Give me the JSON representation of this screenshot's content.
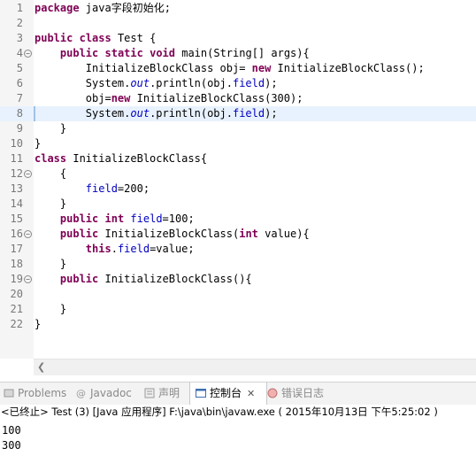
{
  "editor": {
    "lines": [
      {
        "num": "1",
        "parts": [
          [
            "kw",
            "package"
          ],
          [
            "t",
            " java字段初始化;"
          ]
        ]
      },
      {
        "num": "2",
        "parts": []
      },
      {
        "num": "3",
        "parts": [
          [
            "kw",
            "public"
          ],
          [
            "t",
            " "
          ],
          [
            "kw",
            "class"
          ],
          [
            "t",
            " Test {"
          ]
        ]
      },
      {
        "num": "4",
        "fold": true,
        "parts": [
          [
            "t",
            "    "
          ],
          [
            "kw",
            "public"
          ],
          [
            "t",
            " "
          ],
          [
            "kw",
            "static"
          ],
          [
            "t",
            " "
          ],
          [
            "kw",
            "void"
          ],
          [
            "t",
            " main(String[] args){"
          ]
        ]
      },
      {
        "num": "5",
        "parts": [
          [
            "t",
            "        InitializeBlockClass obj= "
          ],
          [
            "kw",
            "new"
          ],
          [
            "t",
            " InitializeBlockClass();"
          ]
        ]
      },
      {
        "num": "6",
        "parts": [
          [
            "t",
            "        System."
          ],
          [
            "st",
            "out"
          ],
          [
            "t",
            ".println(obj."
          ],
          [
            "fld",
            "field"
          ],
          [
            "t",
            ");"
          ]
        ]
      },
      {
        "num": "7",
        "parts": [
          [
            "t",
            "        obj="
          ],
          [
            "kw",
            "new"
          ],
          [
            "t",
            " InitializeBlockClass(300);"
          ]
        ]
      },
      {
        "num": "8",
        "current": true,
        "parts": [
          [
            "t",
            "        System."
          ],
          [
            "st",
            "out"
          ],
          [
            "t",
            ".println(obj."
          ],
          [
            "fld",
            "field"
          ],
          [
            "t",
            ");"
          ]
        ]
      },
      {
        "num": "9",
        "parts": [
          [
            "t",
            "    }"
          ]
        ]
      },
      {
        "num": "10",
        "parts": [
          [
            "t",
            "}"
          ]
        ]
      },
      {
        "num": "11",
        "parts": [
          [
            "kw",
            "class"
          ],
          [
            "t",
            " InitializeBlockClass{"
          ]
        ]
      },
      {
        "num": "12",
        "fold": true,
        "parts": [
          [
            "t",
            "    {"
          ]
        ]
      },
      {
        "num": "13",
        "parts": [
          [
            "t",
            "        "
          ],
          [
            "fld",
            "field"
          ],
          [
            "t",
            "=200;"
          ]
        ]
      },
      {
        "num": "14",
        "parts": [
          [
            "t",
            "    }"
          ]
        ]
      },
      {
        "num": "15",
        "parts": [
          [
            "t",
            "    "
          ],
          [
            "kw",
            "public"
          ],
          [
            "t",
            " "
          ],
          [
            "kw",
            "int"
          ],
          [
            "t",
            " "
          ],
          [
            "fld",
            "field"
          ],
          [
            "t",
            "=100;"
          ]
        ]
      },
      {
        "num": "16",
        "fold": true,
        "parts": [
          [
            "t",
            "    "
          ],
          [
            "kw",
            "public"
          ],
          [
            "t",
            " InitializeBlockClass("
          ],
          [
            "kw",
            "int"
          ],
          [
            "t",
            " value){"
          ]
        ]
      },
      {
        "num": "17",
        "parts": [
          [
            "t",
            "        "
          ],
          [
            "kw",
            "this"
          ],
          [
            "t",
            "."
          ],
          [
            "fld",
            "field"
          ],
          [
            "t",
            "=value;"
          ]
        ]
      },
      {
        "num": "18",
        "parts": [
          [
            "t",
            "    }"
          ]
        ]
      },
      {
        "num": "19",
        "fold": true,
        "parts": [
          [
            "t",
            "    "
          ],
          [
            "kw",
            "public"
          ],
          [
            "t",
            " InitializeBlockClass(){"
          ]
        ]
      },
      {
        "num": "20",
        "parts": []
      },
      {
        "num": "21",
        "parts": [
          [
            "t",
            "    }"
          ]
        ]
      },
      {
        "num": "22",
        "parts": [
          [
            "t",
            "}"
          ]
        ]
      }
    ]
  },
  "tabs": [
    {
      "label": "Problems",
      "icon": "problems-icon",
      "active": false
    },
    {
      "label": "Javadoc",
      "icon": "javadoc-icon",
      "active": false
    },
    {
      "label": "声明",
      "icon": "declaration-icon",
      "active": false
    },
    {
      "label": "控制台",
      "icon": "console-icon",
      "active": true,
      "close": "✕"
    },
    {
      "label": "错误日志",
      "icon": "error-log-icon",
      "active": false
    }
  ],
  "console": {
    "header": "<已终止> Test (3) [Java 应用程序] F:\\java\\bin\\javaw.exe ( 2015年10月13日 下午5:25:02 )",
    "output": [
      "100",
      "300"
    ]
  },
  "colors": {
    "keyword": "#7f0055",
    "field": "#0000c0",
    "current_line": "#e8f2fe"
  }
}
